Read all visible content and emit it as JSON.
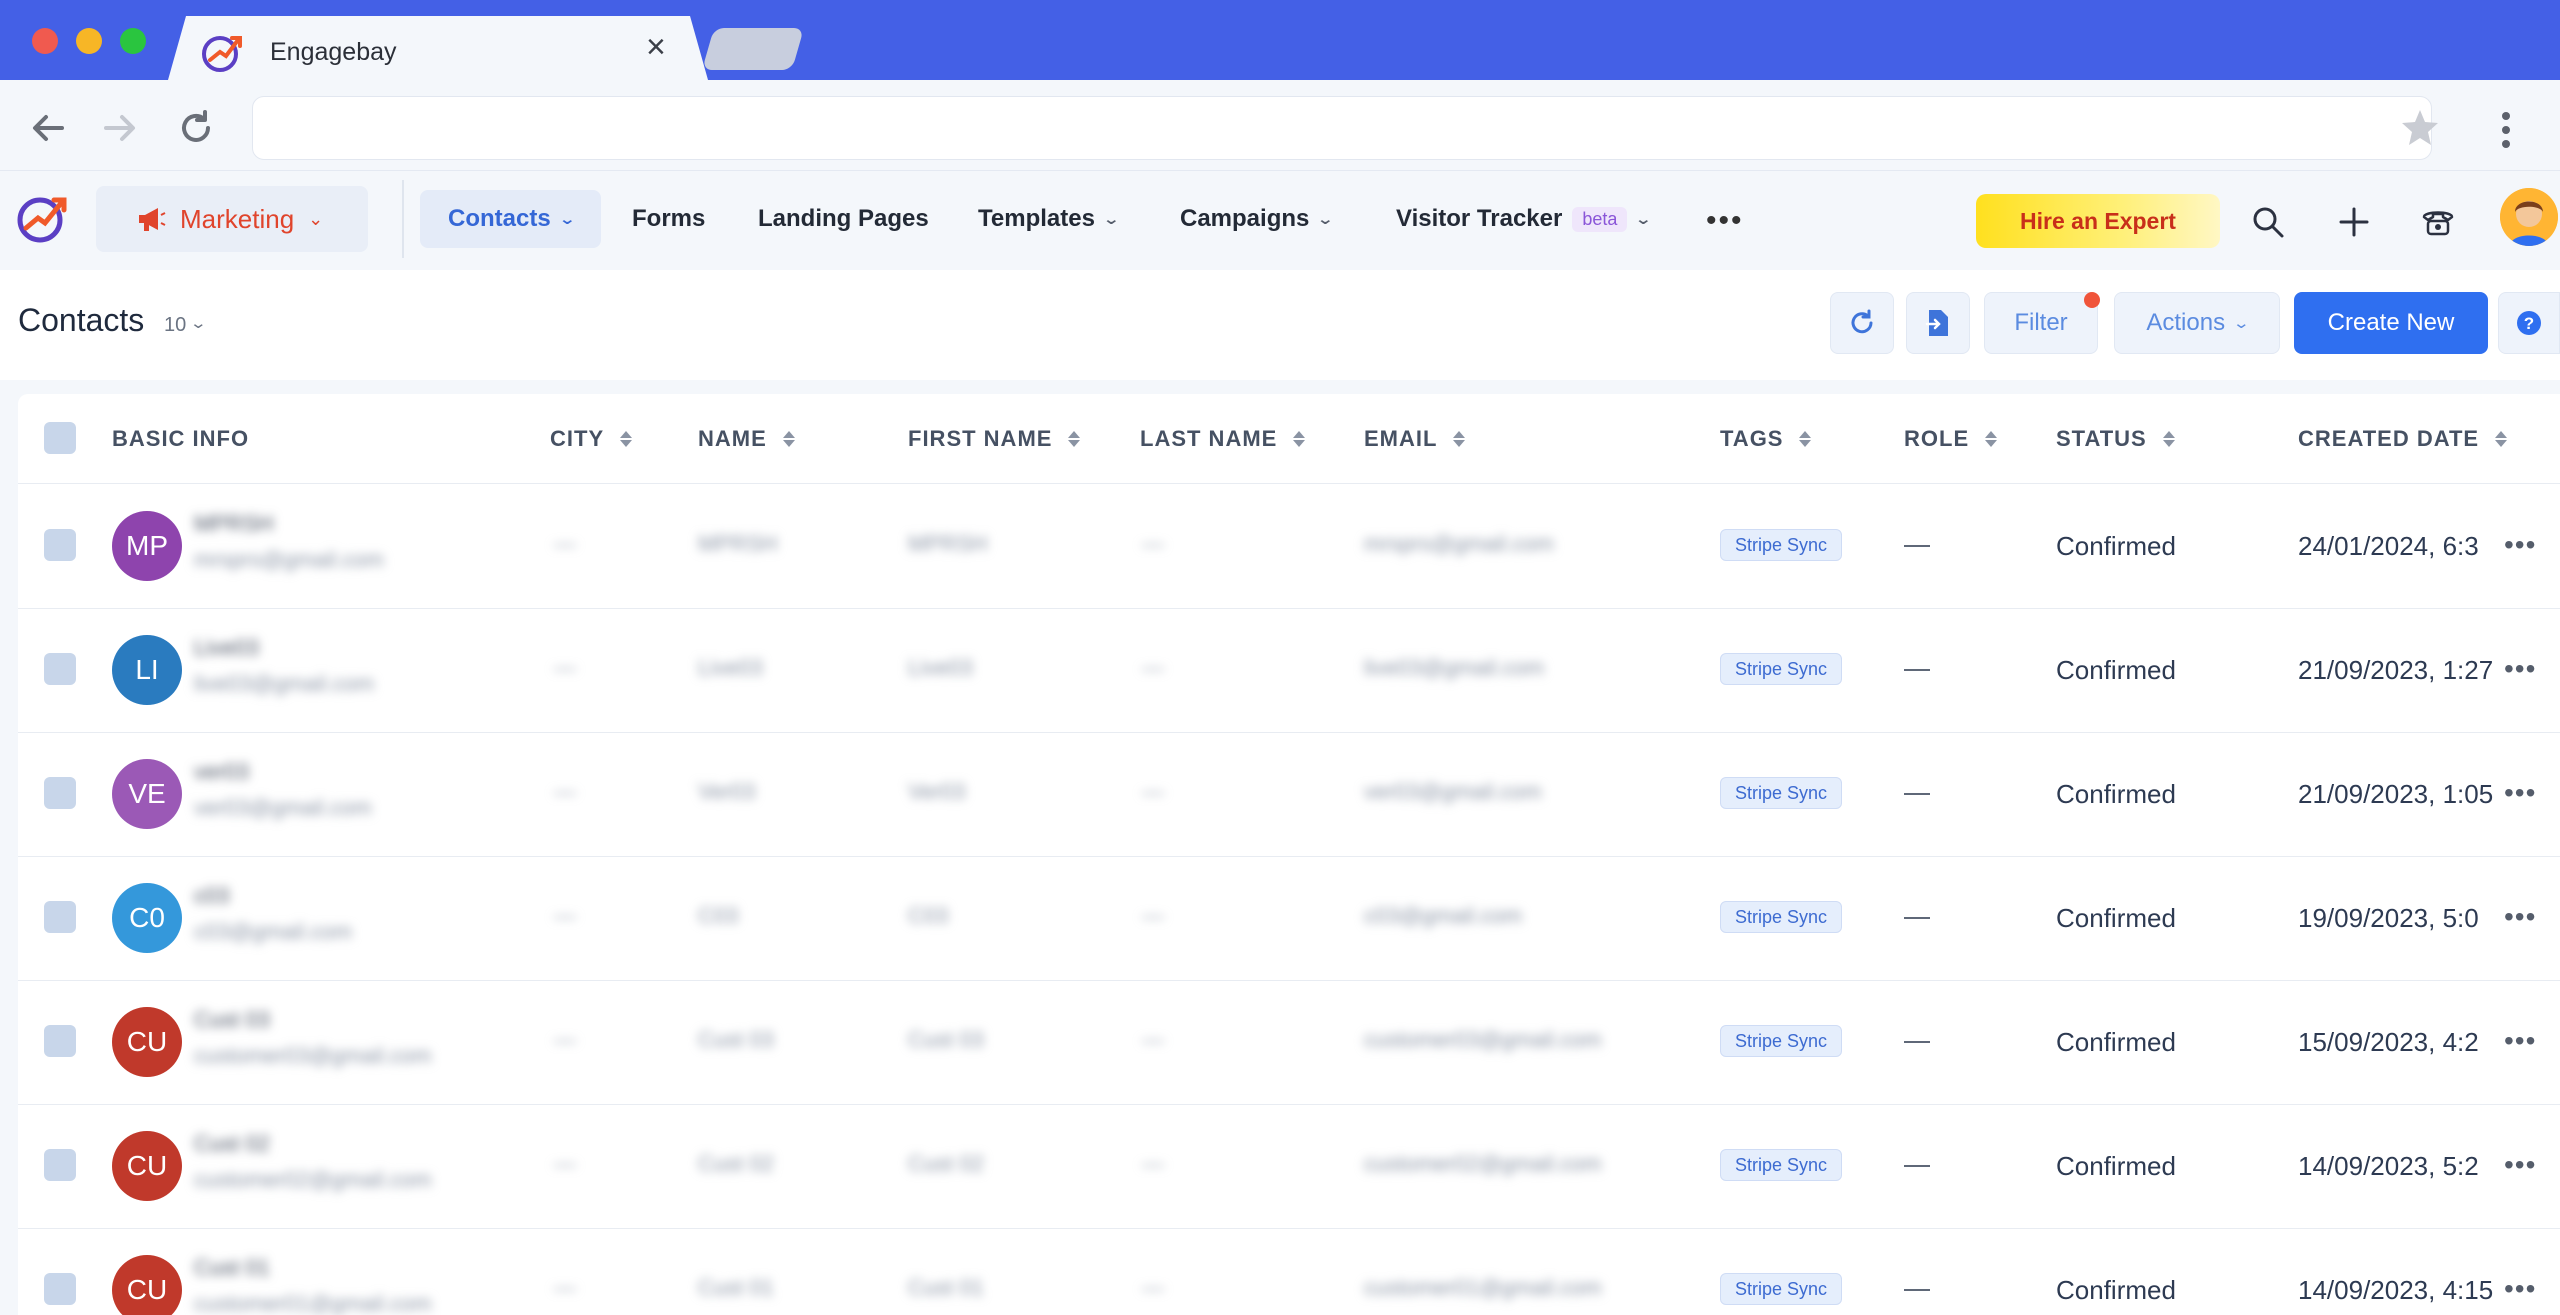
{
  "browser": {
    "tab_title": "Engagebay",
    "tab_close": "×"
  },
  "header": {
    "module_label": "Marketing",
    "nav": [
      {
        "label": "Contacts",
        "active": true,
        "dropdown": true
      },
      {
        "label": "Forms"
      },
      {
        "label": "Landing Pages"
      },
      {
        "label": "Templates",
        "dropdown": true
      },
      {
        "label": "Campaigns",
        "dropdown": true
      },
      {
        "label": "Visitor Tracker",
        "badge": "beta",
        "dropdown": true
      }
    ],
    "more": "•••",
    "hire_label": "Hire an Expert",
    "icons": [
      "search-icon",
      "plus-icon",
      "phone-icon",
      "user-avatar"
    ]
  },
  "toolbar": {
    "title": "Contacts",
    "count": "10",
    "filter_label": "Filter",
    "actions_label": "Actions",
    "create_label": "Create New",
    "help": "?"
  },
  "table": {
    "columns": [
      "BASIC INFO",
      "CITY",
      "NAME",
      "FIRST NAME",
      "LAST NAME",
      "EMAIL",
      "TAGS",
      "ROLE",
      "STATUS",
      "CREATED DATE"
    ],
    "rows": [
      {
        "initials": "MP",
        "color": "#8e44ad",
        "name": "MPRSH",
        "email_sub": "mrsprs@gmail.com",
        "city": "—",
        "full": "MPRSH",
        "first": "MPRSH",
        "last": "—",
        "email": "mrsprs@gmail.com",
        "tag": "Stripe Sync",
        "role": "—",
        "status": "Confirmed",
        "date": "24/01/2024, 6:3"
      },
      {
        "initials": "LI",
        "color": "#2a7bbf",
        "name": "Live03",
        "email_sub": "live03@gmail.com",
        "city": "—",
        "full": "Live03",
        "first": "Live03",
        "last": "—",
        "email": "live03@gmail.com",
        "tag": "Stripe Sync",
        "role": "—",
        "status": "Confirmed",
        "date": "21/09/2023, 1:27"
      },
      {
        "initials": "VE",
        "color": "#9b59b6",
        "name": "ver03",
        "email_sub": "ver03@gmail.com",
        "city": "—",
        "full": "Ver03",
        "first": "Ver03",
        "last": "—",
        "email": "ver03@gmail.com",
        "tag": "Stripe Sync",
        "role": "—",
        "status": "Confirmed",
        "date": "21/09/2023, 1:05"
      },
      {
        "initials": "C0",
        "color": "#3498db",
        "name": "c03",
        "email_sub": "c03@gmail.com",
        "city": "—",
        "full": "C03",
        "first": "C03",
        "last": "—",
        "email": "c03@gmail.com",
        "tag": "Stripe Sync",
        "role": "—",
        "status": "Confirmed",
        "date": "19/09/2023, 5:0"
      },
      {
        "initials": "CU",
        "color": "#c0392b",
        "name": "Cust 03",
        "email_sub": "customer03@gmail.com",
        "city": "—",
        "full": "Cust 03",
        "first": "Cust 03",
        "last": "—",
        "email": "customer03@gmail.com",
        "tag": "Stripe Sync",
        "role": "—",
        "status": "Confirmed",
        "date": "15/09/2023, 4:2"
      },
      {
        "initials": "CU",
        "color": "#c0392b",
        "name": "Cust 02",
        "email_sub": "customer02@gmail.com",
        "city": "—",
        "full": "Cust 02",
        "first": "Cust 02",
        "last": "—",
        "email": "customer02@gmail.com",
        "tag": "Stripe Sync",
        "role": "—",
        "status": "Confirmed",
        "date": "14/09/2023, 5:2"
      },
      {
        "initials": "CU",
        "color": "#c0392b",
        "name": "Cust 01",
        "email_sub": "customer01@gmail.com",
        "city": "—",
        "full": "Cust 01",
        "first": "Cust 01",
        "last": "—",
        "email": "customer01@gmail.com",
        "tag": "Stripe Sync",
        "role": "—",
        "status": "Confirmed",
        "date": "14/09/2023, 4:15"
      }
    ],
    "row_more": "•••"
  },
  "colors": {
    "browser_bar": "#4460e6",
    "accent": "#2f6ff0",
    "module": "#e0442c",
    "hire_gradient_start": "#ffe01e"
  }
}
